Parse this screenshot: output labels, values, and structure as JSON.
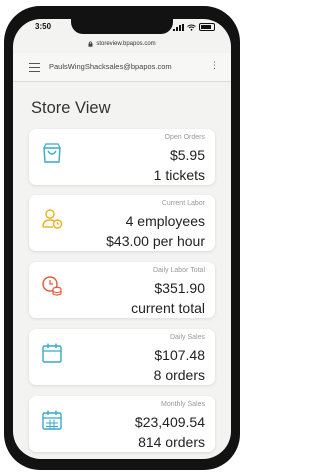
{
  "status": {
    "time": "3:50"
  },
  "browser": {
    "url": "storeview.bpapos.com"
  },
  "header": {
    "email": "PaulsWingShacksales@bpapos.com"
  },
  "page": {
    "title": "Store View"
  },
  "cards": [
    {
      "label": "Open Orders",
      "line1": "$5.95",
      "line2": "1 tickets",
      "icon": "shopping-bag-icon",
      "color": "#39a9c6"
    },
    {
      "label": "Current Labor",
      "line1": "4 employees",
      "line2": "$43.00 per hour",
      "icon": "user-clock-icon",
      "color": "#e8b31c"
    },
    {
      "label": "Daily Labor Total",
      "line1": "$351.90",
      "line2": "current total",
      "icon": "coins-clock-icon",
      "color": "#e35a3c"
    },
    {
      "label": "Daily Sales",
      "line1": "$107.48",
      "line2": "8 orders",
      "icon": "calendar-icon",
      "color": "#39a9c6"
    },
    {
      "label": "Monthly Sales",
      "line1": "$23,409.54",
      "line2": "814 orders",
      "icon": "calendar-grid-icon",
      "color": "#39a9c6"
    }
  ]
}
